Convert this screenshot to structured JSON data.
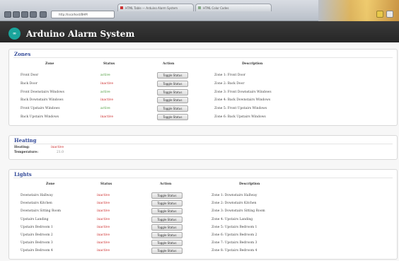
{
  "browser": {
    "address": "http://localhost/BHM",
    "tabs": [
      {
        "title": "HTML Table — Arduino Alarm System"
      },
      {
        "title": "HTML Color Codes"
      }
    ]
  },
  "app": {
    "logo_text": "∞",
    "title": "Arduino Alarm System"
  },
  "zones": {
    "title": "Zones",
    "headers": {
      "zone": "Zone",
      "status": "Status",
      "action": "Action",
      "description": "Description"
    },
    "rows": [
      {
        "zone": "Front Door",
        "status": "active",
        "action": "Toggle Status",
        "description": "Zone 1: Front Door"
      },
      {
        "zone": "Back Door",
        "status": "inactive",
        "action": "Toggle Status",
        "description": "Zone 2: Back Door"
      },
      {
        "zone": "Front Downstairs Windows",
        "status": "active",
        "action": "Toggle Status",
        "description": "Zone 3: Front Downstairs Windows"
      },
      {
        "zone": "Back Downstairs Windows",
        "status": "inactive",
        "action": "Toggle Status",
        "description": "Zone 4: Back Downstairs Windows"
      },
      {
        "zone": "Front Upstairs Windows",
        "status": "active",
        "action": "Toggle Status",
        "description": "Zone 5: Front Upstairs Windows"
      },
      {
        "zone": "Back Upstairs Windows",
        "status": "inactive",
        "action": "Toggle Status",
        "description": "Zone 6: Back Upstairs Windows"
      }
    ]
  },
  "heating": {
    "title": "Heating",
    "items": [
      {
        "label": "Heating:",
        "value": "inactive"
      },
      {
        "label": "Temperature:",
        "value": "21.0"
      }
    ]
  },
  "lights": {
    "title": "Lights",
    "headers": {
      "zone": "Zone",
      "status": "Status",
      "action": "Action",
      "description": "Description"
    },
    "rows": [
      {
        "zone": "Downstairs Hallway",
        "status": "inactive",
        "action": "Toggle Status",
        "description": "Zone 1: Downstairs Hallway"
      },
      {
        "zone": "Downstairs Kitchen",
        "status": "inactive",
        "action": "Toggle Status",
        "description": "Zone 2: Downstairs Kitchen"
      },
      {
        "zone": "Downstairs Sitting Room",
        "status": "inactive",
        "action": "Toggle Status",
        "description": "Zone 3: Downstairs Sitting Room"
      },
      {
        "zone": "Upstairs Landing",
        "status": "inactive",
        "action": "Toggle Status",
        "description": "Zone 4: Upstairs Landing"
      },
      {
        "zone": "Upstairs Bedroom 1",
        "status": "inactive",
        "action": "Toggle Status",
        "description": "Zone 5: Upstairs Bedroom 1"
      },
      {
        "zone": "Upstairs Bedroom 2",
        "status": "inactive",
        "action": "Toggle Status",
        "description": "Zone 6: Upstairs Bedroom 2"
      },
      {
        "zone": "Upstairs Bedroom 3",
        "status": "inactive",
        "action": "Toggle Status",
        "description": "Zone 7: Upstairs Bedroom 3"
      },
      {
        "zone": "Upstairs Bedroom 4",
        "status": "inactive",
        "action": "Toggle Status",
        "description": "Zone 8: Upstairs Bedroom 4"
      }
    ]
  },
  "colors": {
    "active": "#4a9a3a",
    "inactive": "#cc2a2a",
    "title": "#334a99",
    "header_bg": "#2e2e2e",
    "logo": "#1aa49b"
  }
}
